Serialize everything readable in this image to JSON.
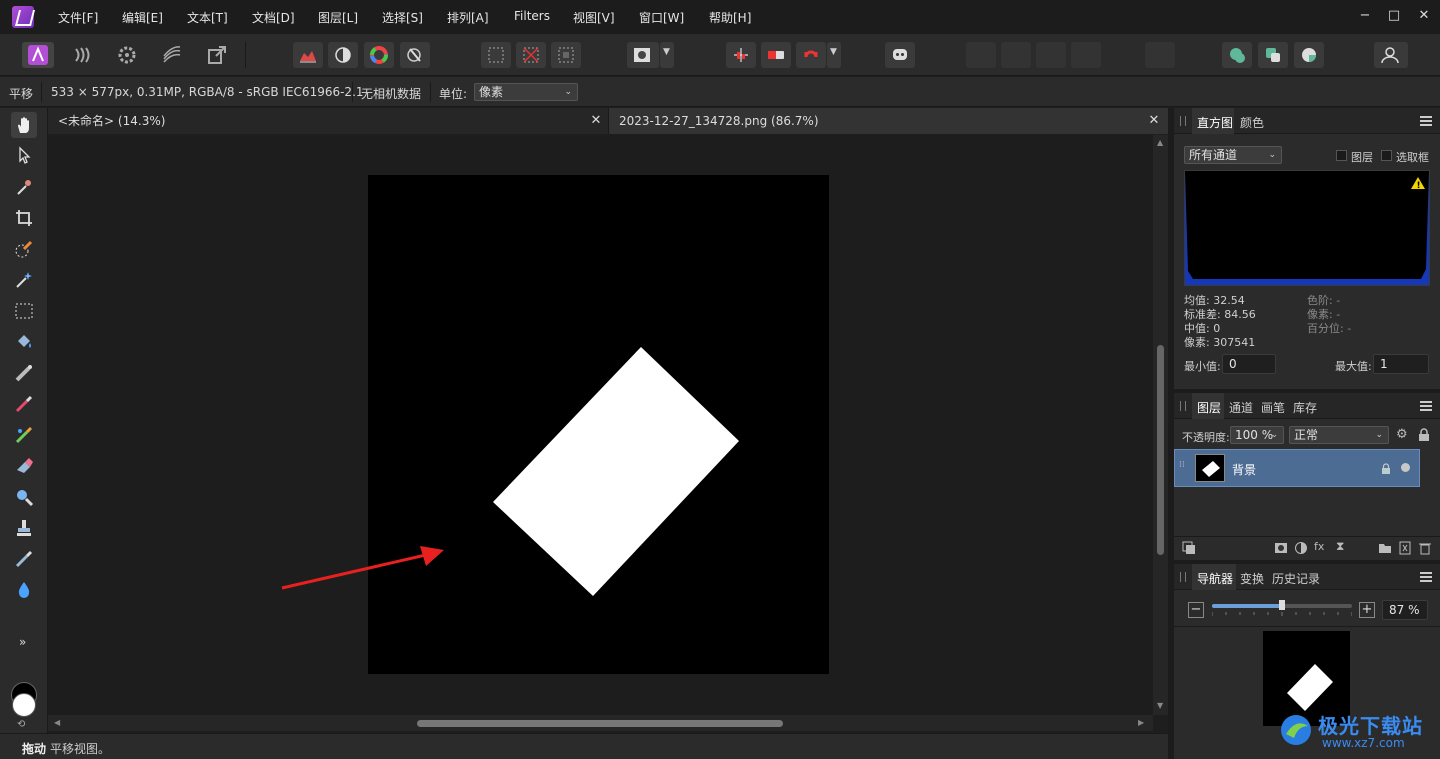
{
  "menu": {
    "items": [
      "文件[F]",
      "编辑[E]",
      "文本[T]",
      "文档[D]",
      "图层[L]",
      "选择[S]",
      "排列[A]",
      "Filters",
      "视图[V]",
      "窗口[W]",
      "帮助[H]"
    ]
  },
  "window_controls": {
    "minimize": "−",
    "maximize": "□",
    "close": "✕"
  },
  "context_bar": {
    "tool_name": "平移",
    "image_info": "533 × 577px, 0.31MP, RGBA/8 - sRGB IEC61966-2.1",
    "camera_data": "无相机数据",
    "unit_label": "单位:",
    "unit_value": "像素"
  },
  "tabs": [
    {
      "label": "<未命名> (14.3%)",
      "close": "✕"
    },
    {
      "label": "2023-12-27_134728.png (86.7%)",
      "close": "✕"
    }
  ],
  "status": {
    "bold": "拖动",
    "text": "平移视图。"
  },
  "histogram_panel": {
    "tabs": [
      "直方图",
      "颜色"
    ],
    "channel_select": "所有通道",
    "layer_check": "图层",
    "selection_check": "选取框",
    "stats_left": [
      "均值: 32.54",
      "标准差: 84.56",
      "中值: 0",
      "像素: 307541"
    ],
    "stats_right": [
      "色阶: -",
      "像素: -",
      "百分位: -"
    ],
    "min_label": "最小值:",
    "min_value": "0",
    "max_label": "最大值:",
    "max_value": "1"
  },
  "layers_panel": {
    "tabs": [
      "图层",
      "通道",
      "画笔",
      "库存"
    ],
    "opacity_label": "不透明度:",
    "opacity_value": "100 %",
    "blend_mode": "正常",
    "layer_name": "背景"
  },
  "navigator_panel": {
    "tabs": [
      "导航器",
      "变换",
      "历史记录"
    ],
    "zoom_value": "87 %",
    "zoom_fraction": 0.5
  },
  "watermark": {
    "cn": "极光下载站",
    "url": "www.xz7.com"
  },
  "colors": {
    "accent": "#b34fd6",
    "selected_layer": "#4d6c94",
    "arrow": "#e8201f"
  }
}
